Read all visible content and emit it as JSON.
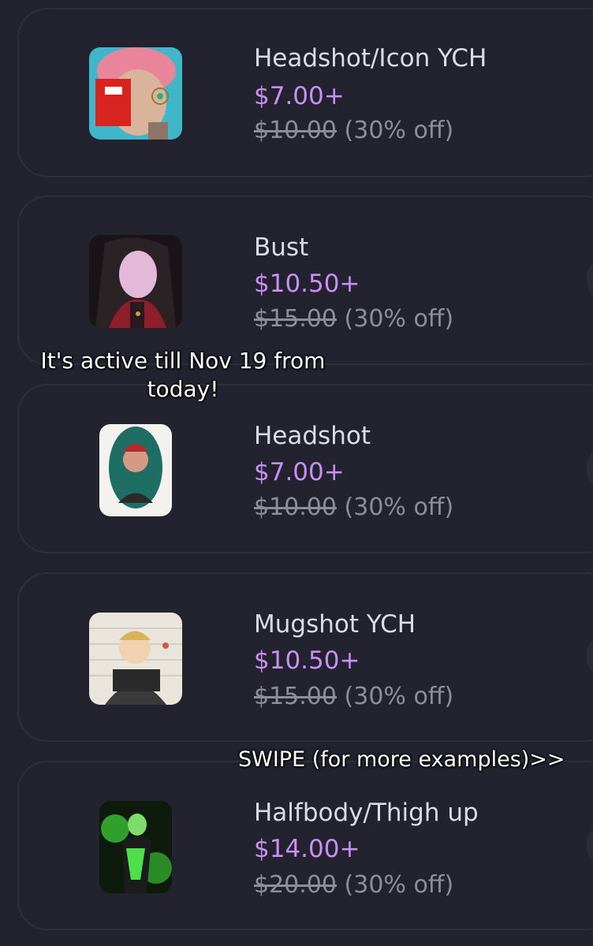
{
  "overlays": {
    "promo_line1": "It's active till Nov 19 from",
    "promo_line2": "today!",
    "swipe": "SWIPE (for more examples)>>"
  },
  "items": [
    {
      "title": "Headshot/Icon YCH",
      "price": "$7.00+",
      "original_price": "$10.00",
      "discount": "(30% off)"
    },
    {
      "title": "Bust",
      "price": "$10.50+",
      "original_price": "$15.00",
      "discount": "(30% off)"
    },
    {
      "title": "Headshot",
      "price": "$7.00+",
      "original_price": "$10.00",
      "discount": "(30% off)"
    },
    {
      "title": "Mugshot YCH",
      "price": "$10.50+",
      "original_price": "$15.00",
      "discount": "(30% off)"
    },
    {
      "title": "Halfbody/Thigh up",
      "price": "$14.00+",
      "original_price": "$20.00",
      "discount": "(30% off)"
    }
  ],
  "colors": {
    "background": "#232330",
    "card_border": "#2f2f3c",
    "title": "#dcdce6",
    "price": "#c98ff2",
    "original_price": "#8e8e98"
  }
}
